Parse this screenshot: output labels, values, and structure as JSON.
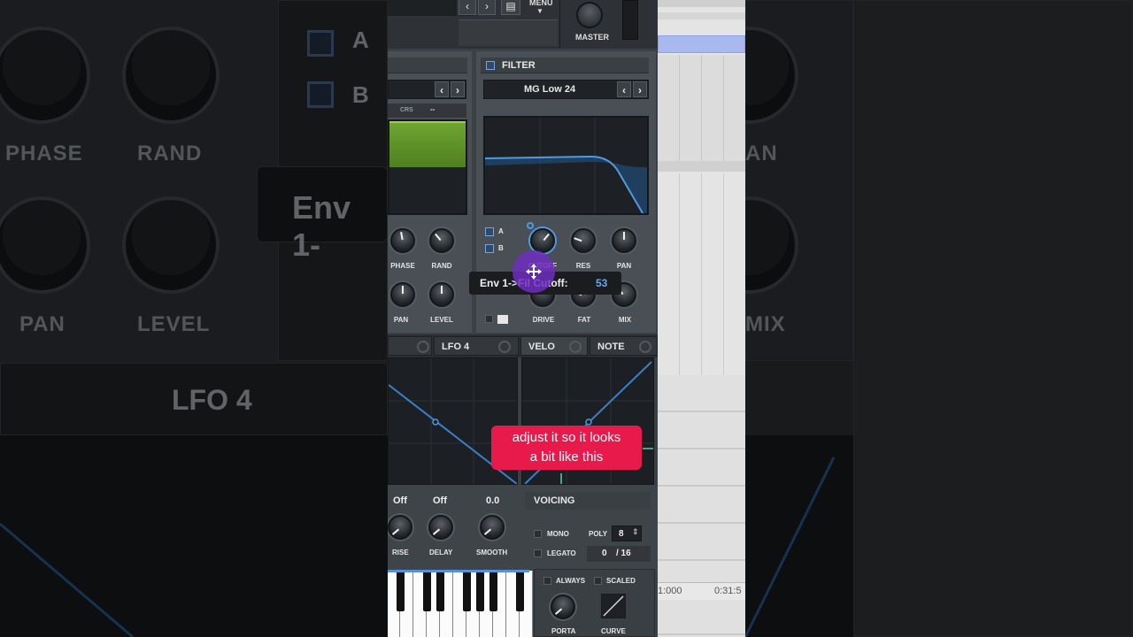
{
  "background": {
    "left_labels": [
      "PHASE",
      "RAND",
      "PAN",
      "LEVEL"
    ],
    "middle_labels": [
      "A",
      "B"
    ],
    "env_text": "Env 1-",
    "lfo_label": "LFO 4",
    "right_labels": [
      "AN",
      "MIX"
    ],
    "right_marks": [
      "1:000",
      "0:31:5"
    ]
  },
  "topbar": {
    "menu_label": "MENU",
    "master_label": "MASTER"
  },
  "osc_panel": {
    "crs_label": "CRS",
    "crs_value": "--",
    "knobs": [
      "PHASE",
      "RAND",
      "PAN",
      "LEVEL"
    ]
  },
  "filter": {
    "title": "FILTER",
    "preset": "MG Low 24",
    "route_a": "A",
    "route_b": "B",
    "knobs": [
      "CUTOFF",
      "RES",
      "PAN",
      "DRIVE",
      "FAT",
      "MIX"
    ]
  },
  "tooltip": {
    "label": "Env 1->Fil Cutoff:",
    "value": "53"
  },
  "mod_tabs": {
    "lfo4": "LFO 4",
    "velo": "VELO",
    "note": "NOTE"
  },
  "lfo_settings": {
    "rise_value": "Off",
    "delay_value": "Off",
    "smooth_value": "0.0",
    "rise_label": "RISE",
    "delay_label": "DELAY",
    "smooth_label": "SMOOTH"
  },
  "voicing": {
    "title": "VOICING",
    "mono_label": "MONO",
    "poly_label": "POLY",
    "poly_value": "8",
    "legato_label": "LEGATO",
    "voices_used": "0",
    "voices_total": "/ 16"
  },
  "porta": {
    "always_label": "ALWAYS",
    "scaled_label": "SCALED",
    "porta_label": "PORTA",
    "curve_label": "CURVE"
  },
  "caption": {
    "line1": "adjust it so it looks",
    "line2": "a bit like this"
  },
  "colors": {
    "accent_blue": "#4f9ae0",
    "green_display": "#5b8f24",
    "caption_red": "#e8194b",
    "cursor_purple": "#6e2dbe"
  }
}
